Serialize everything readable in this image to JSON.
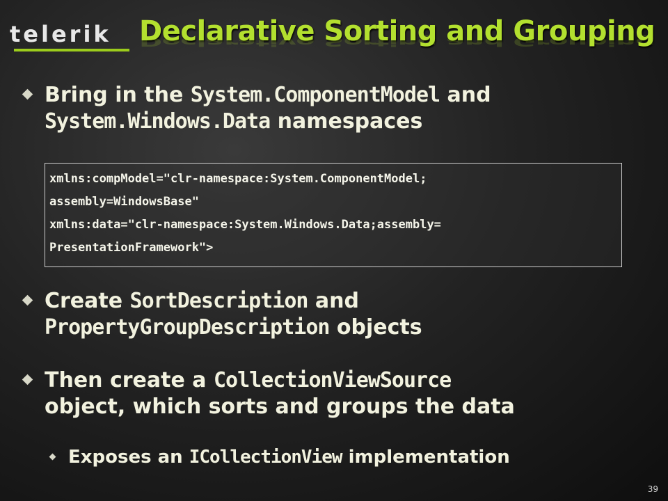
{
  "logo": {
    "text": "telerik"
  },
  "title": "Declarative Sorting and Grouping",
  "bullets": [
    {
      "line1": {
        "a": "Bring in the ",
        "code": "System.ComponentModel",
        "b": " and"
      },
      "line2": {
        "code": "System.Windows.Data",
        "b": " namespaces"
      }
    },
    {
      "line1": {
        "a": "Create ",
        "code": "SortDescription",
        "b": " and"
      },
      "line2": {
        "code": "PropertyGroupDescription",
        "b": " objects"
      }
    },
    {
      "line1": {
        "a": "Then create a ",
        "code": "CollectionViewSource"
      },
      "line2": {
        "a": "object, which sorts and groups the data"
      }
    }
  ],
  "code_lines": [
    "xmlns:compModel=\"clr-namespace:System.ComponentModel;",
    "assembly=WindowsBase\"",
    "xmlns:data=\"clr-namespace:System.Windows.Data;assembly=",
    "PresentationFramework\">"
  ],
  "sub_bullet": {
    "a": "Exposes an ",
    "code": "ICollectionView",
    "b": " implementation"
  },
  "page_number": "39",
  "colors": {
    "title": "#b3e02f",
    "accent": "#9ccc1c",
    "text": "#f2f2df"
  }
}
